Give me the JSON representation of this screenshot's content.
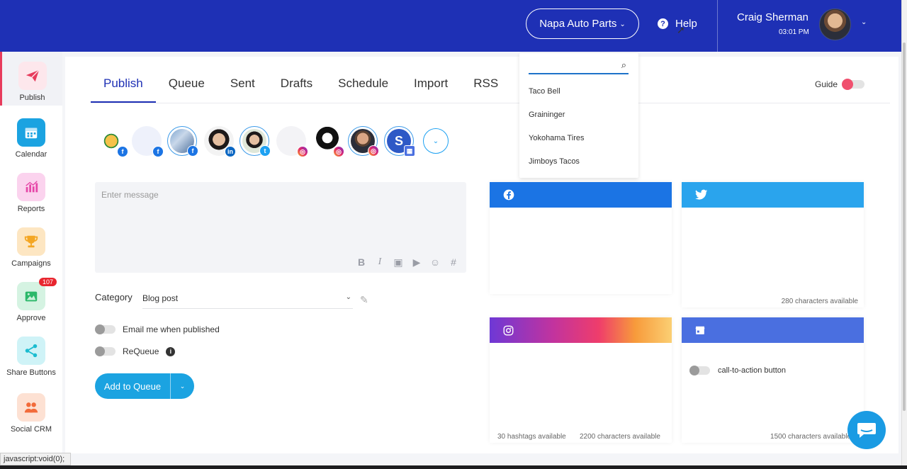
{
  "header": {
    "company": "Napa Auto Parts",
    "help_label": "Help",
    "user_name": "Craig Sherman",
    "time": "03:01 PM"
  },
  "sidebar": {
    "items": [
      {
        "label": "Publish",
        "icon": "paper-plane-icon",
        "color": "#e73b5c"
      },
      {
        "label": "Calendar",
        "icon": "calendar-icon",
        "color": "#1ba3e1"
      },
      {
        "label": "Reports",
        "icon": "bar-chart-icon",
        "color": "#e647a8"
      },
      {
        "label": "Campaigns",
        "icon": "trophy-icon",
        "color": "#f4a623"
      },
      {
        "label": "Approve",
        "icon": "image-check-icon",
        "color": "#2cb86a",
        "badge": "107"
      },
      {
        "label": "Share Buttons",
        "icon": "share-icon",
        "color": "#1bbcd0"
      },
      {
        "label": "Social CRM",
        "icon": "people-icon",
        "color": "#f26b3a"
      }
    ]
  },
  "tabs": [
    "Publish",
    "Queue",
    "Sent",
    "Drafts",
    "Schedule",
    "Import",
    "RSS"
  ],
  "guide_label": "Guide",
  "composer": {
    "placeholder": "Enter message",
    "tools": [
      "B",
      "I",
      "▣",
      "▶",
      "☺",
      "#"
    ]
  },
  "category": {
    "label": "Category",
    "value": "Blog post"
  },
  "options": {
    "email_label": "Email me when published",
    "requeue_label": "ReQueue"
  },
  "add_to_queue": "Add to Queue",
  "previews": {
    "twitter_footer": "280 characters available",
    "instagram_hashtags": "30 hashtags available",
    "instagram_chars": "2200 characters available",
    "gmb_cta": "call-to-action button",
    "gmb_footer": "1500 characters available"
  },
  "dropdown": {
    "items": [
      "Taco Bell",
      "Graininger",
      "Yokohama Tires",
      "Jimboys Tacos"
    ]
  },
  "status_bar": "javascript:void(0);"
}
